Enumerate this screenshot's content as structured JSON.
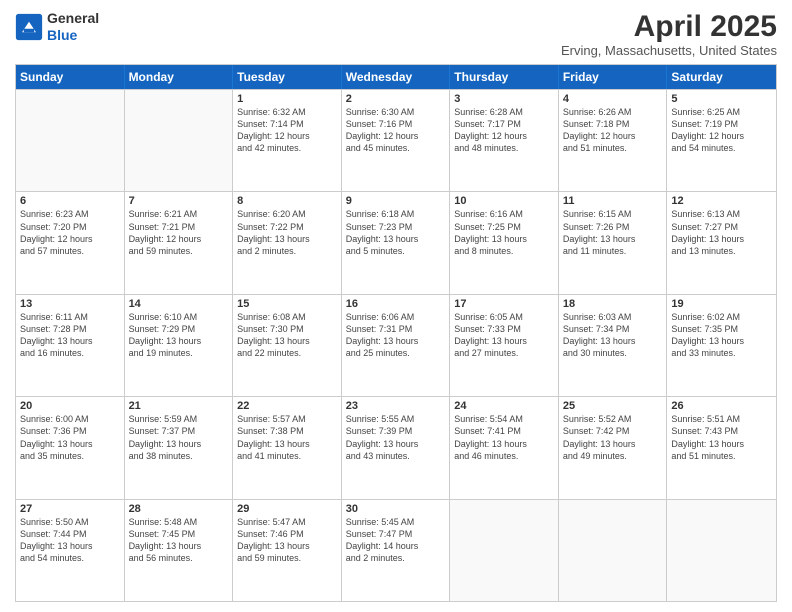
{
  "header": {
    "logo_general": "General",
    "logo_blue": "Blue",
    "month_title": "April 2025",
    "location": "Erving, Massachusetts, United States"
  },
  "weekdays": [
    "Sunday",
    "Monday",
    "Tuesday",
    "Wednesday",
    "Thursday",
    "Friday",
    "Saturday"
  ],
  "rows": [
    [
      {
        "day": "",
        "lines": []
      },
      {
        "day": "",
        "lines": []
      },
      {
        "day": "1",
        "lines": [
          "Sunrise: 6:32 AM",
          "Sunset: 7:14 PM",
          "Daylight: 12 hours",
          "and 42 minutes."
        ]
      },
      {
        "day": "2",
        "lines": [
          "Sunrise: 6:30 AM",
          "Sunset: 7:16 PM",
          "Daylight: 12 hours",
          "and 45 minutes."
        ]
      },
      {
        "day": "3",
        "lines": [
          "Sunrise: 6:28 AM",
          "Sunset: 7:17 PM",
          "Daylight: 12 hours",
          "and 48 minutes."
        ]
      },
      {
        "day": "4",
        "lines": [
          "Sunrise: 6:26 AM",
          "Sunset: 7:18 PM",
          "Daylight: 12 hours",
          "and 51 minutes."
        ]
      },
      {
        "day": "5",
        "lines": [
          "Sunrise: 6:25 AM",
          "Sunset: 7:19 PM",
          "Daylight: 12 hours",
          "and 54 minutes."
        ]
      }
    ],
    [
      {
        "day": "6",
        "lines": [
          "Sunrise: 6:23 AM",
          "Sunset: 7:20 PM",
          "Daylight: 12 hours",
          "and 57 minutes."
        ]
      },
      {
        "day": "7",
        "lines": [
          "Sunrise: 6:21 AM",
          "Sunset: 7:21 PM",
          "Daylight: 12 hours",
          "and 59 minutes."
        ]
      },
      {
        "day": "8",
        "lines": [
          "Sunrise: 6:20 AM",
          "Sunset: 7:22 PM",
          "Daylight: 13 hours",
          "and 2 minutes."
        ]
      },
      {
        "day": "9",
        "lines": [
          "Sunrise: 6:18 AM",
          "Sunset: 7:23 PM",
          "Daylight: 13 hours",
          "and 5 minutes."
        ]
      },
      {
        "day": "10",
        "lines": [
          "Sunrise: 6:16 AM",
          "Sunset: 7:25 PM",
          "Daylight: 13 hours",
          "and 8 minutes."
        ]
      },
      {
        "day": "11",
        "lines": [
          "Sunrise: 6:15 AM",
          "Sunset: 7:26 PM",
          "Daylight: 13 hours",
          "and 11 minutes."
        ]
      },
      {
        "day": "12",
        "lines": [
          "Sunrise: 6:13 AM",
          "Sunset: 7:27 PM",
          "Daylight: 13 hours",
          "and 13 minutes."
        ]
      }
    ],
    [
      {
        "day": "13",
        "lines": [
          "Sunrise: 6:11 AM",
          "Sunset: 7:28 PM",
          "Daylight: 13 hours",
          "and 16 minutes."
        ]
      },
      {
        "day": "14",
        "lines": [
          "Sunrise: 6:10 AM",
          "Sunset: 7:29 PM",
          "Daylight: 13 hours",
          "and 19 minutes."
        ]
      },
      {
        "day": "15",
        "lines": [
          "Sunrise: 6:08 AM",
          "Sunset: 7:30 PM",
          "Daylight: 13 hours",
          "and 22 minutes."
        ]
      },
      {
        "day": "16",
        "lines": [
          "Sunrise: 6:06 AM",
          "Sunset: 7:31 PM",
          "Daylight: 13 hours",
          "and 25 minutes."
        ]
      },
      {
        "day": "17",
        "lines": [
          "Sunrise: 6:05 AM",
          "Sunset: 7:33 PM",
          "Daylight: 13 hours",
          "and 27 minutes."
        ]
      },
      {
        "day": "18",
        "lines": [
          "Sunrise: 6:03 AM",
          "Sunset: 7:34 PM",
          "Daylight: 13 hours",
          "and 30 minutes."
        ]
      },
      {
        "day": "19",
        "lines": [
          "Sunrise: 6:02 AM",
          "Sunset: 7:35 PM",
          "Daylight: 13 hours",
          "and 33 minutes."
        ]
      }
    ],
    [
      {
        "day": "20",
        "lines": [
          "Sunrise: 6:00 AM",
          "Sunset: 7:36 PM",
          "Daylight: 13 hours",
          "and 35 minutes."
        ]
      },
      {
        "day": "21",
        "lines": [
          "Sunrise: 5:59 AM",
          "Sunset: 7:37 PM",
          "Daylight: 13 hours",
          "and 38 minutes."
        ]
      },
      {
        "day": "22",
        "lines": [
          "Sunrise: 5:57 AM",
          "Sunset: 7:38 PM",
          "Daylight: 13 hours",
          "and 41 minutes."
        ]
      },
      {
        "day": "23",
        "lines": [
          "Sunrise: 5:55 AM",
          "Sunset: 7:39 PM",
          "Daylight: 13 hours",
          "and 43 minutes."
        ]
      },
      {
        "day": "24",
        "lines": [
          "Sunrise: 5:54 AM",
          "Sunset: 7:41 PM",
          "Daylight: 13 hours",
          "and 46 minutes."
        ]
      },
      {
        "day": "25",
        "lines": [
          "Sunrise: 5:52 AM",
          "Sunset: 7:42 PM",
          "Daylight: 13 hours",
          "and 49 minutes."
        ]
      },
      {
        "day": "26",
        "lines": [
          "Sunrise: 5:51 AM",
          "Sunset: 7:43 PM",
          "Daylight: 13 hours",
          "and 51 minutes."
        ]
      }
    ],
    [
      {
        "day": "27",
        "lines": [
          "Sunrise: 5:50 AM",
          "Sunset: 7:44 PM",
          "Daylight: 13 hours",
          "and 54 minutes."
        ]
      },
      {
        "day": "28",
        "lines": [
          "Sunrise: 5:48 AM",
          "Sunset: 7:45 PM",
          "Daylight: 13 hours",
          "and 56 minutes."
        ]
      },
      {
        "day": "29",
        "lines": [
          "Sunrise: 5:47 AM",
          "Sunset: 7:46 PM",
          "Daylight: 13 hours",
          "and 59 minutes."
        ]
      },
      {
        "day": "30",
        "lines": [
          "Sunrise: 5:45 AM",
          "Sunset: 7:47 PM",
          "Daylight: 14 hours",
          "and 2 minutes."
        ]
      },
      {
        "day": "",
        "lines": []
      },
      {
        "day": "",
        "lines": []
      },
      {
        "day": "",
        "lines": []
      }
    ]
  ]
}
